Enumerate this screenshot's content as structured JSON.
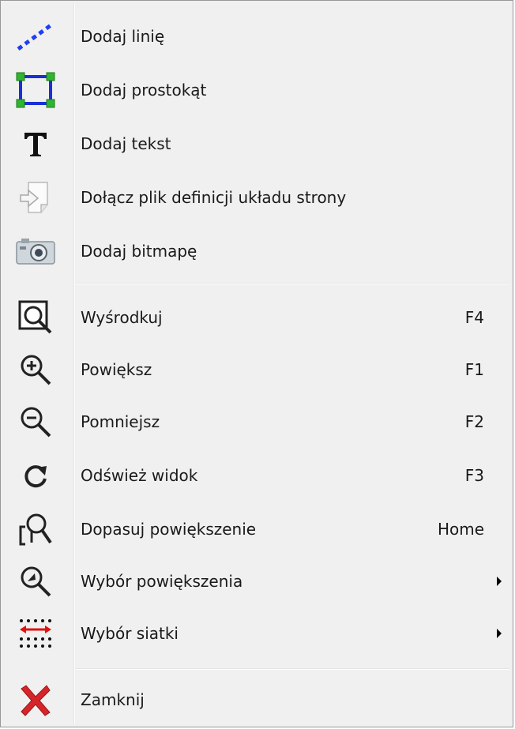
{
  "menu": {
    "items": [
      {
        "label": "Dodaj linię",
        "icon": "dashed-line-icon",
        "shortcut": ""
      },
      {
        "label": "Dodaj prostokąt",
        "icon": "rectangle-icon",
        "shortcut": ""
      },
      {
        "label": "Dodaj tekst",
        "icon": "text-icon",
        "shortcut": ""
      },
      {
        "label": "Dołącz plik definicji układu strony",
        "icon": "import-file-icon",
        "shortcut": ""
      },
      {
        "label": "Dodaj bitmapę",
        "icon": "camera-icon",
        "shortcut": ""
      },
      {
        "label": "Wyśrodkuj",
        "icon": "zoom-center-icon",
        "shortcut": "F4"
      },
      {
        "label": "Powiększ",
        "icon": "zoom-in-icon",
        "shortcut": "F1"
      },
      {
        "label": "Pomniejsz",
        "icon": "zoom-out-icon",
        "shortcut": "F2"
      },
      {
        "label": "Odśwież widok",
        "icon": "refresh-icon",
        "shortcut": "F3"
      },
      {
        "label": "Dopasuj powiększenie",
        "icon": "zoom-fit-icon",
        "shortcut": "Home"
      },
      {
        "label": "Wybór powiększenia",
        "icon": "zoom-select-icon",
        "shortcut": "",
        "submenu": true
      },
      {
        "label": "Wybór siatki",
        "icon": "grid-icon",
        "shortcut": "",
        "submenu": true
      },
      {
        "label": "Zamknij",
        "icon": "close-icon",
        "shortcut": ""
      }
    ]
  },
  "colors": {
    "menu_background": "#f0f0f0",
    "line_icon": "#1f3ff0",
    "rect_border": "#1a2fd6",
    "rect_handle": "#2fb52f",
    "grid_arrow": "#e01010",
    "close_icon": "#d4262a"
  }
}
